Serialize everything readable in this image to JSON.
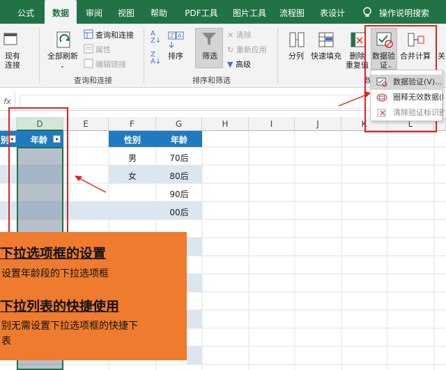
{
  "tabs": [
    "公式",
    "数据",
    "审阅",
    "视图",
    "帮助",
    "PDF工具",
    "图片工具",
    "流程图",
    "表设计",
    "操作说明搜索"
  ],
  "ribbon": {
    "existing": "现有\n连接",
    "refresh_all": "全部刷新",
    "query_conn": "查询和连接",
    "properties": "属性",
    "edit_links": "编辑链接",
    "group_query": "查询和连接",
    "sort": "排序",
    "filter": "筛选",
    "clear": "清除",
    "reapply": "重新应用",
    "advanced": "高级",
    "group_sort": "排序和筛选",
    "split": "分列",
    "flash_fill": "快速填充",
    "remove_dup": "删除\n重复值",
    "validation": "数据验\n证",
    "consolidate": "合并计算",
    "relations": "关",
    "group_tools_partial": "数"
  },
  "formula_bar": {
    "fx": "fx"
  },
  "columns": [
    "D",
    "E",
    "F",
    "G",
    "H",
    "I",
    "J",
    "K",
    "L"
  ],
  "table": {
    "hdr_partial": "别",
    "hdr_age": "年龄",
    "hdr_gender": "性别",
    "hdr_age2": "年龄",
    "genders": [
      "男",
      "女"
    ],
    "ages": [
      "70后",
      "80后",
      "90后",
      "00后"
    ]
  },
  "dropdown": {
    "items": [
      "数据验证(V)...",
      "圈释无效数据(I)",
      "清除验证标识圈(R)"
    ]
  },
  "overlay": {
    "h1": "下拉选项框的设置",
    "t1": "设置年龄段的下拉选项框",
    "h2": "下拉列表的快捷使用",
    "t2a": "别无需设置下拉选项框的快捷下",
    "t2b": "表"
  },
  "colors": {
    "excel_green": "#217346",
    "orange": "#ee7b2e",
    "highlight": "#e02020",
    "table_blue": "#1f7bc1"
  }
}
